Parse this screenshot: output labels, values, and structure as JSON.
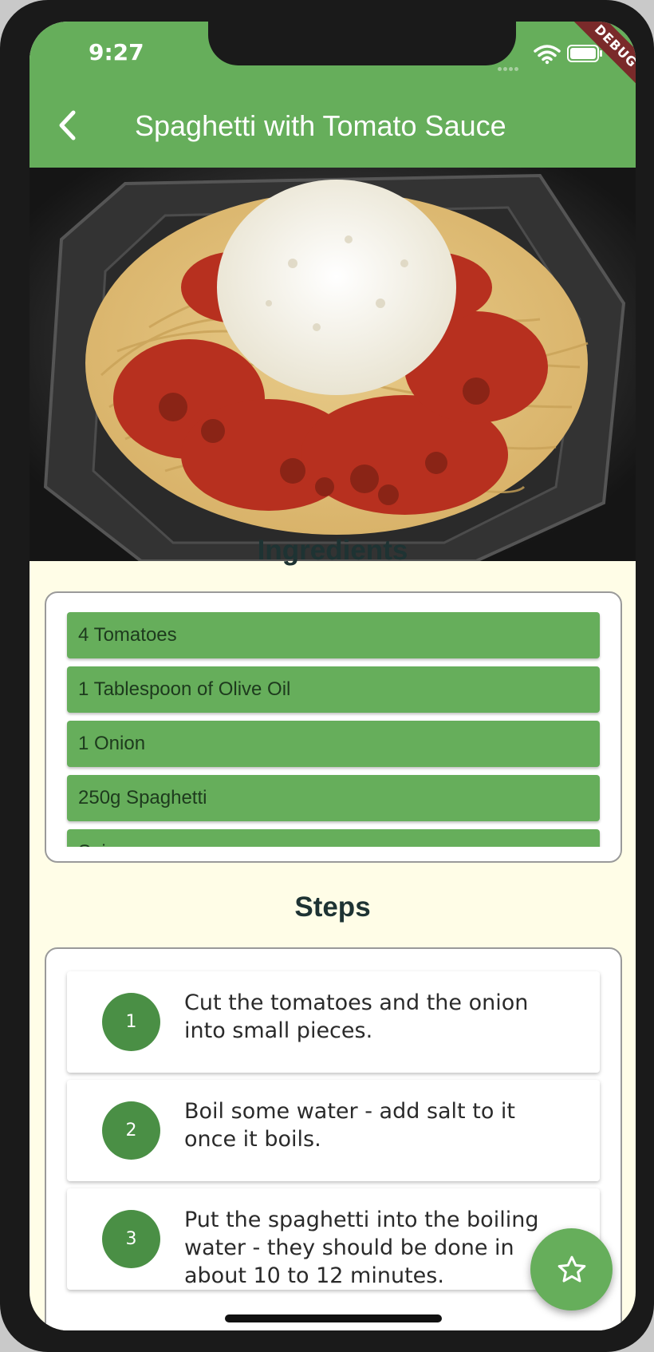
{
  "status_bar": {
    "time": "9:27",
    "debug_label": "DEBUG"
  },
  "app_bar": {
    "title": "Spaghetti with Tomato Sauce"
  },
  "ingredients": {
    "heading": "Ingredients",
    "items": [
      "4 Tomatoes",
      "1 Tablespoon of Olive Oil",
      "1 Onion",
      "250g Spaghetti",
      "Spices"
    ]
  },
  "steps": {
    "heading": "Steps",
    "items": [
      {
        "number": "1",
        "text": "Cut the tomatoes and the onion into small pieces."
      },
      {
        "number": "2",
        "text": "Boil some water - add salt to it once it boils."
      },
      {
        "number": "3",
        "text": "Put the spaghetti into the boiling water - they should be done in about 10 to 12 minutes."
      }
    ]
  },
  "colors": {
    "primary": "#66ae5b",
    "background": "#fffde7",
    "step_circle": "#4a8f45",
    "heading_text": "#1e3333"
  },
  "icons": {
    "back": "chevron-left-icon",
    "favorite": "star-outline-icon"
  }
}
